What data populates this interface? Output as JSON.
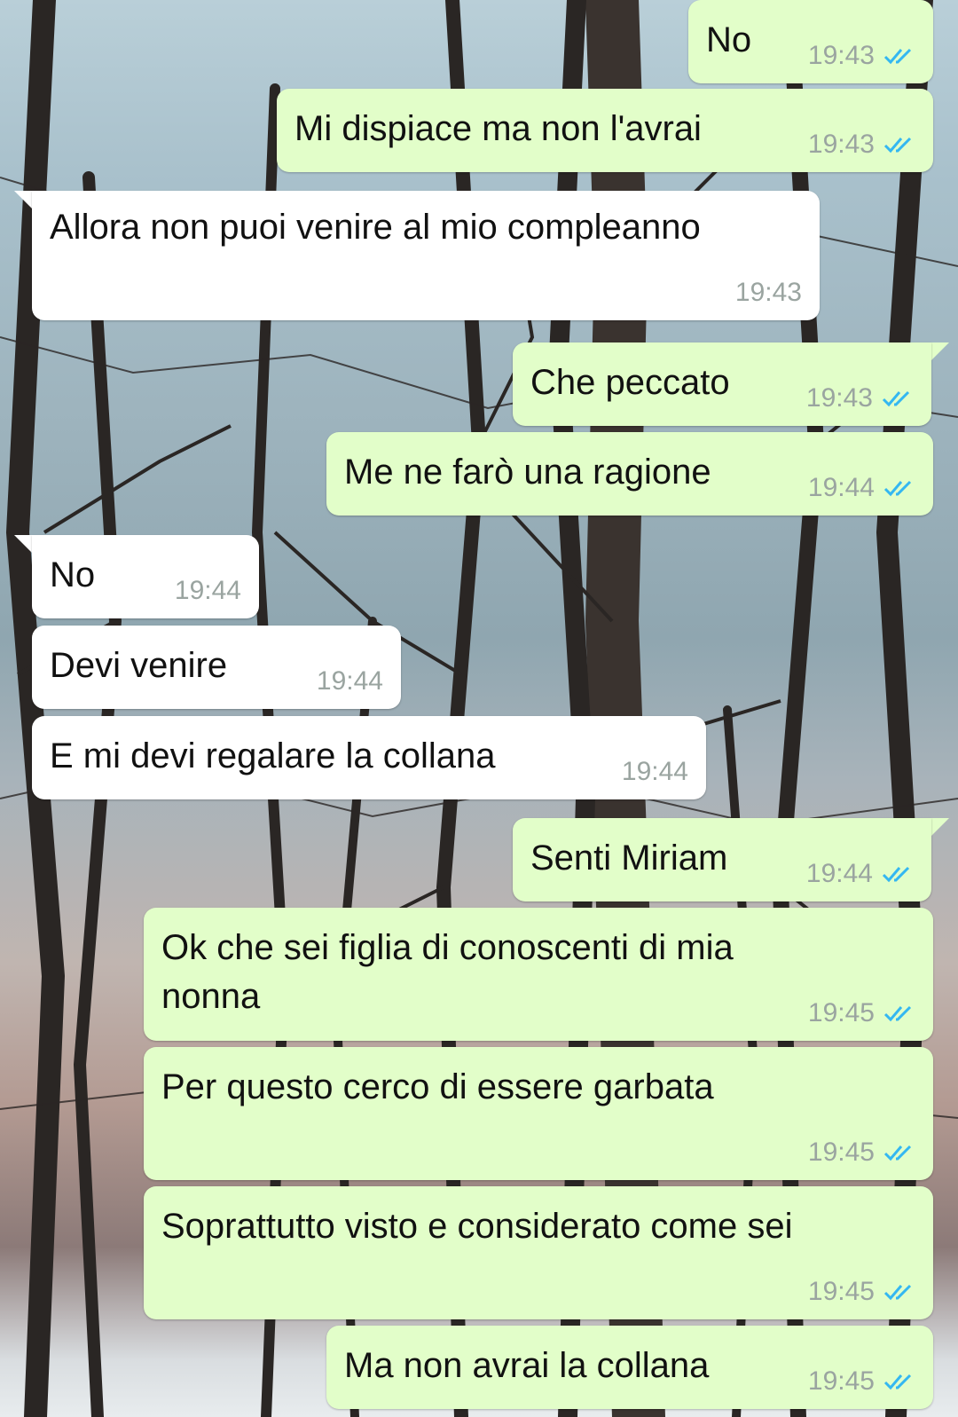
{
  "colors": {
    "outgoing_bubble": "#e2fec9",
    "incoming_bubble": "#ffffff",
    "time_text": "#9aa4a0",
    "read_ticks": "#34b7f1"
  },
  "icons": {
    "read_status": "double-check-icon"
  },
  "messages": [
    {
      "direction": "out",
      "text": "No",
      "time": "19:43",
      "status": "read"
    },
    {
      "direction": "out",
      "text": "Mi dispiace ma non l'avrai",
      "time": "19:43",
      "status": "read"
    },
    {
      "direction": "in",
      "text": "Allora non puoi venire al mio compleanno",
      "time": "19:43"
    },
    {
      "direction": "out",
      "text": "Che peccato",
      "time": "19:43",
      "status": "read"
    },
    {
      "direction": "out",
      "text": "Me ne farò una ragione",
      "time": "19:44",
      "status": "read"
    },
    {
      "direction": "in",
      "text": "No",
      "time": "19:44"
    },
    {
      "direction": "in",
      "text": "Devi venire",
      "time": "19:44"
    },
    {
      "direction": "in",
      "text": "E mi devi regalare la collana",
      "time": "19:44"
    },
    {
      "direction": "out",
      "text": "Senti Miriam",
      "time": "19:44",
      "status": "read"
    },
    {
      "direction": "out",
      "text": "Ok che sei figlia di conoscenti di mia nonna",
      "time": "19:45",
      "status": "read"
    },
    {
      "direction": "out",
      "text": "Per questo cerco di essere garbata",
      "time": "19:45",
      "status": "read"
    },
    {
      "direction": "out",
      "text": "Soprattutto visto e considerato come sei",
      "time": "19:45",
      "status": "read"
    },
    {
      "direction": "out",
      "text": "Ma non avrai la collana",
      "time": "19:45",
      "status": "read"
    }
  ]
}
